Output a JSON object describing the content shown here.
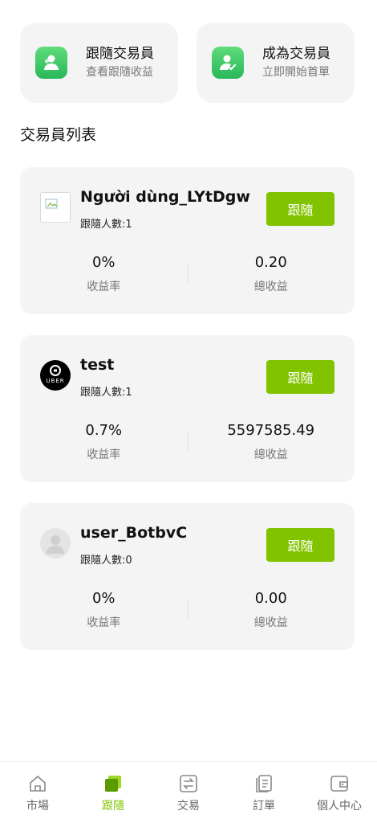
{
  "quick_cards": [
    {
      "title": "跟隨交易員",
      "subtitle": "查看跟隨收益",
      "icon": "users-icon"
    },
    {
      "title": "成為交易員",
      "subtitle": "立即開始首單",
      "icon": "user-check-icon"
    }
  ],
  "section_title": "交易員列表",
  "traders": [
    {
      "name": "Người dùng_LYtDgw",
      "followers": "跟隨人數:1",
      "button": "跟隨",
      "yield_value": "0%",
      "yield_label": "收益率",
      "profit_value": "0.20",
      "profit_label": "總收益",
      "avatar": "broken-image"
    },
    {
      "name": "test",
      "followers": "跟隨人數:1",
      "button": "跟隨",
      "yield_value": "0.7%",
      "yield_label": "收益率",
      "profit_value": "5597585.49",
      "profit_label": "總收益",
      "avatar": "uber-logo"
    },
    {
      "name": "user_BotbvC",
      "followers": "跟隨人數:0",
      "button": "跟隨",
      "yield_value": "0%",
      "yield_label": "收益率",
      "profit_value": "0.00",
      "profit_label": "總收益",
      "avatar": "default-user"
    }
  ],
  "uber_logo_text": "UBER",
  "nav": [
    {
      "label": "市場",
      "icon": "home-icon",
      "active": false
    },
    {
      "label": "跟隨",
      "icon": "follow-icon",
      "active": true
    },
    {
      "label": "交易",
      "icon": "exchange-icon",
      "active": false
    },
    {
      "label": "訂單",
      "icon": "orders-icon",
      "active": false
    },
    {
      "label": "個人中心",
      "icon": "wallet-icon",
      "active": false
    }
  ],
  "colors": {
    "accent": "#82c300",
    "card_bg": "#f4f4f4",
    "icon_green": "#2fbf5e"
  }
}
